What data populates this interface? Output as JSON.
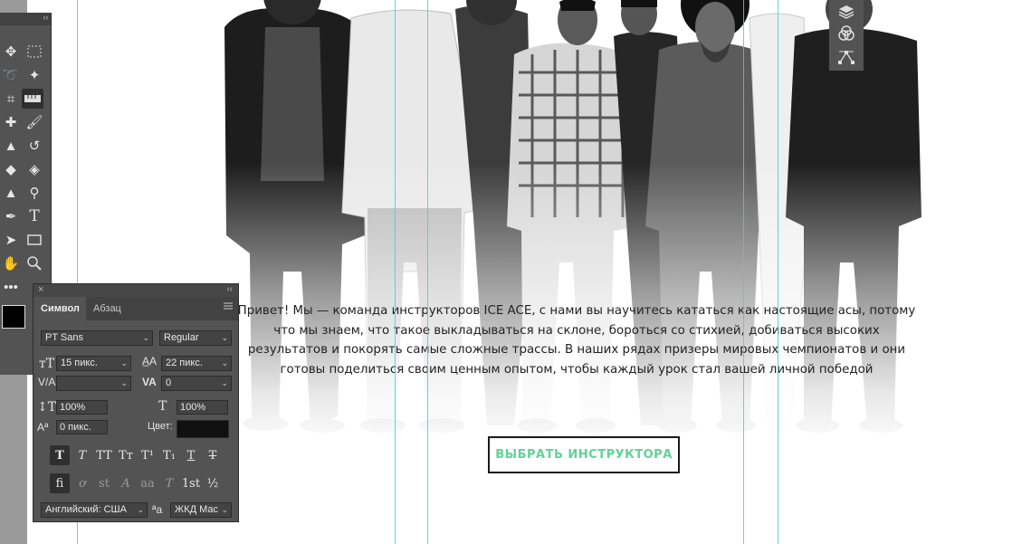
{
  "intro_text": "Привет! Мы — команда инструкторов ICE ACE, с нами вы научитесь кататься как настоящие асы, потому что мы знаем, что такое выкладываться на склоне, бороться со стихией, добиваться высоких результатов и покорять самые сложные трассы. В наших рядах призеры мировых чемпионатов и они готовы поделиться своим ценным опытом, чтобы каждый урок стал вашей личной победой",
  "cta_label": "ВЫБРАТЬ ИНСТРУКТОРА",
  "colors": {
    "guide": "#35d3e0",
    "cta_text": "#5fd396",
    "panel_bg": "#535353"
  },
  "tools_panel": {
    "collapse_glyph": "‹‹",
    "tools": [
      "move-icon",
      "marquee-icon",
      "lasso-icon",
      "magic-wand-icon",
      "crop-icon",
      "ruler-icon",
      "healing-icon",
      "brush-icon",
      "stamp-icon",
      "history-brush-icon",
      "eraser-icon",
      "paint-bucket-icon",
      "blur-icon",
      "dodge-icon",
      "pen-icon",
      "type-icon",
      "path-select-icon",
      "rectangle-icon",
      "hand-icon",
      "zoom-icon",
      "more-icon"
    ]
  },
  "layers_mini": [
    "layers-icon",
    "channels-icon",
    "paths-icon"
  ],
  "character_panel": {
    "close_glyph": "×",
    "collapse_glyph": "‹‹",
    "tabs": [
      "Символ",
      "Абзац"
    ],
    "font_family": "PT Sans",
    "font_style": "Regular",
    "font_size": "15 пикс.",
    "leading": "22 пикс.",
    "kerning": "",
    "tracking": "0",
    "vertical_scale": "100%",
    "horizontal_scale": "100%",
    "baseline_shift": "0 пикс.",
    "color_label": "Цвет:",
    "language": "Английский: США",
    "antialias": "ЖКД Мас",
    "style_buttons": [
      "T",
      "T",
      "TT",
      "Tт",
      "T¹",
      "T₁",
      "T",
      "T"
    ],
    "opentype_buttons": [
      "fi",
      "ơ",
      "st",
      "A",
      "aa",
      "T",
      "1st",
      "½"
    ]
  }
}
